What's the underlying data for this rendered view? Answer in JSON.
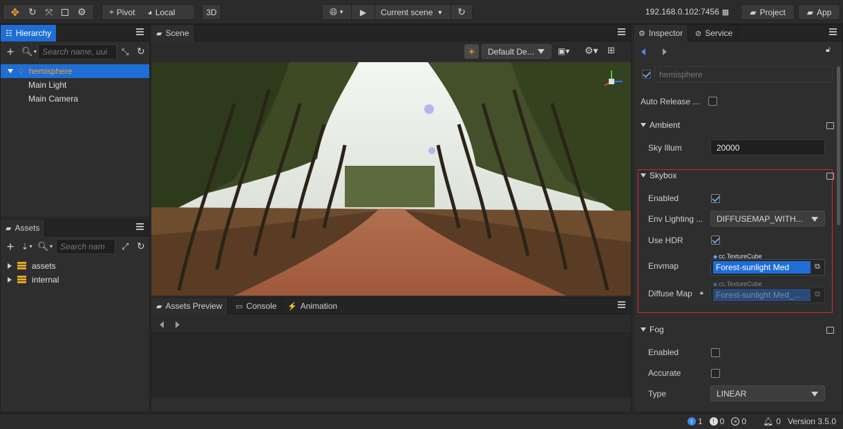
{
  "toolbar": {
    "pivot": "Pivot",
    "local": "Local",
    "mode3d": "3D",
    "scene_select": "Current scene",
    "address": "192.168.0.102:7456",
    "project": "Project",
    "app": "App"
  },
  "hierarchy": {
    "tab": "Hierarchy",
    "search_placeholder": "Search name, uui",
    "items": [
      "hemisphere",
      "Main Light",
      "Main Camera"
    ]
  },
  "assets": {
    "tab": "Assets",
    "search_placeholder": "Search nam",
    "items": [
      "assets",
      "internal"
    ]
  },
  "scene": {
    "tab": "Scene",
    "camera_select": "Default De..."
  },
  "bottom_tabs": [
    "Assets Preview",
    "Console",
    "Animation"
  ],
  "inspector": {
    "tabs": [
      "Inspector",
      "Service"
    ],
    "node_name": "hemisphere",
    "auto_release": "Auto Release ...",
    "ambient": {
      "title": "Ambient",
      "sky_illum_label": "Sky Illum",
      "sky_illum_value": "20000"
    },
    "skybox": {
      "title": "Skybox",
      "enabled_label": "Enabled",
      "env_lighting_label": "Env Lighting ...",
      "env_lighting_value": "DIFFUSEMAP_WITH...",
      "use_hdr_label": "Use HDR",
      "envmap_label": "Envmap",
      "envmap_type": "cc.TextureCube",
      "envmap_value": "Forest-sunlight Med",
      "diffuse_label": "Diffuse Map",
      "diffuse_type": "cc.TextureCube",
      "diffuse_value": "Forest-sunlight Med_..."
    },
    "fog": {
      "title": "Fog",
      "enabled_label": "Enabled",
      "accurate_label": "Accurate",
      "type_label": "Type",
      "type_value": "LINEAR"
    }
  },
  "status": {
    "info": "1",
    "warn": "0",
    "error": "0",
    "bell": "0",
    "version": "Version 3.5.0"
  },
  "colors": {
    "accent": "#1e6ed6",
    "highlight_border": "#e0242a",
    "selected_node": "#f0a030"
  }
}
